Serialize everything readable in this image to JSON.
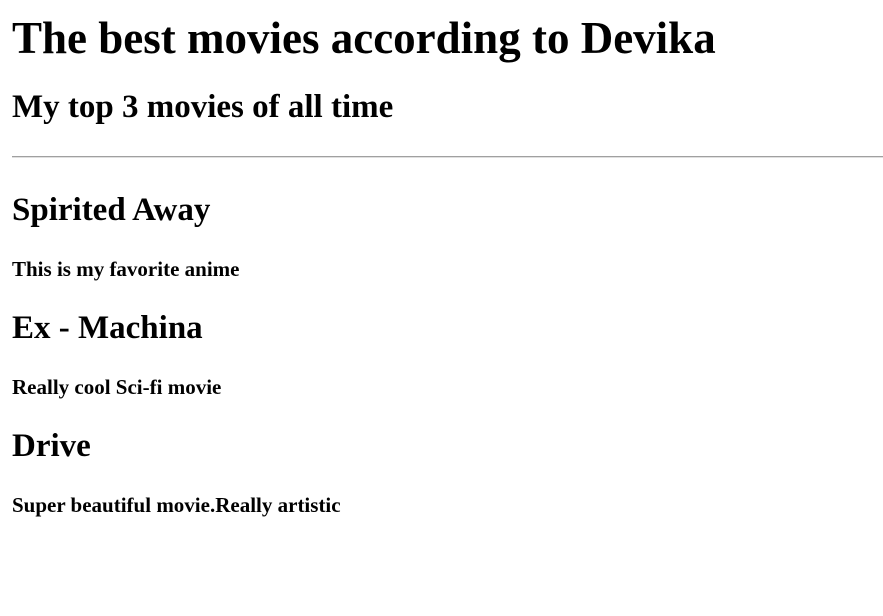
{
  "header": {
    "title": "The best movies according to Devika",
    "subtitle": "My top 3 movies of all time"
  },
  "movies": [
    {
      "title": "Spirited Away",
      "description": "This is my favorite anime"
    },
    {
      "title": "Ex - Machina",
      "description": "Really cool Sci-fi movie"
    },
    {
      "title": "Drive",
      "description": "Super beautiful movie.Really artistic"
    }
  ]
}
